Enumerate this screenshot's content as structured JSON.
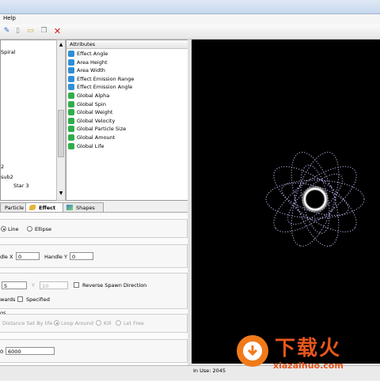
{
  "menu": {
    "help": "Help"
  },
  "tree": {
    "items": [
      {
        "label": "Spiral"
      },
      {
        "label": "2"
      },
      {
        "label": "sub2"
      },
      {
        "label": "Star 3"
      }
    ]
  },
  "attributes": {
    "header": "Attributes",
    "items": [
      {
        "label": "Effect Angle",
        "color": "#2f8fd6"
      },
      {
        "label": "Area Height",
        "color": "#2f8fd6"
      },
      {
        "label": "Area Width",
        "color": "#2f8fd6"
      },
      {
        "label": "Effect Emission Range",
        "color": "#2f8fd6"
      },
      {
        "label": "Effect Emission Angle",
        "color": "#2f8fd6"
      },
      {
        "label": "Global Alpha",
        "color": "#2fae4a"
      },
      {
        "label": "Global Spin",
        "color": "#2fae4a"
      },
      {
        "label": "Global Weight",
        "color": "#2fae4a"
      },
      {
        "label": "Global Velocity",
        "color": "#2fae4a"
      },
      {
        "label": "Global Particle Size",
        "color": "#2fae4a"
      },
      {
        "label": "Global Amount",
        "color": "#2fae4a"
      },
      {
        "label": "Global Life",
        "color": "#2fae4a"
      }
    ]
  },
  "tabs": {
    "particle": "Particle",
    "effect": "Effect",
    "shapes": "Shapes"
  },
  "effect": {
    "line": "Line",
    "ellipse": "Ellipse",
    "handle_x_label": "dle X",
    "handle_x_value": "0",
    "handle_y_label": "Handle Y",
    "handle_y_value": "0",
    "spawn_value": "5",
    "spawn_y_label": "Y",
    "spawn_y_value": "10",
    "reverse_spawn": "Reverse Spawn Direction",
    "wards": "wards",
    "specified": "Specified",
    "gs": "gs",
    "distance_set_by_life": "Distance Set By life",
    "loop_around": "Loop Around",
    "kill": "Kill",
    "let_free": "Let Free",
    "bottom_value_a": "0",
    "bottom_value_b": "6000"
  },
  "status": {
    "in_use": "In Use: 2045"
  },
  "watermark": {
    "cn_text": "下载火",
    "site": "xiazaihuo.com"
  }
}
